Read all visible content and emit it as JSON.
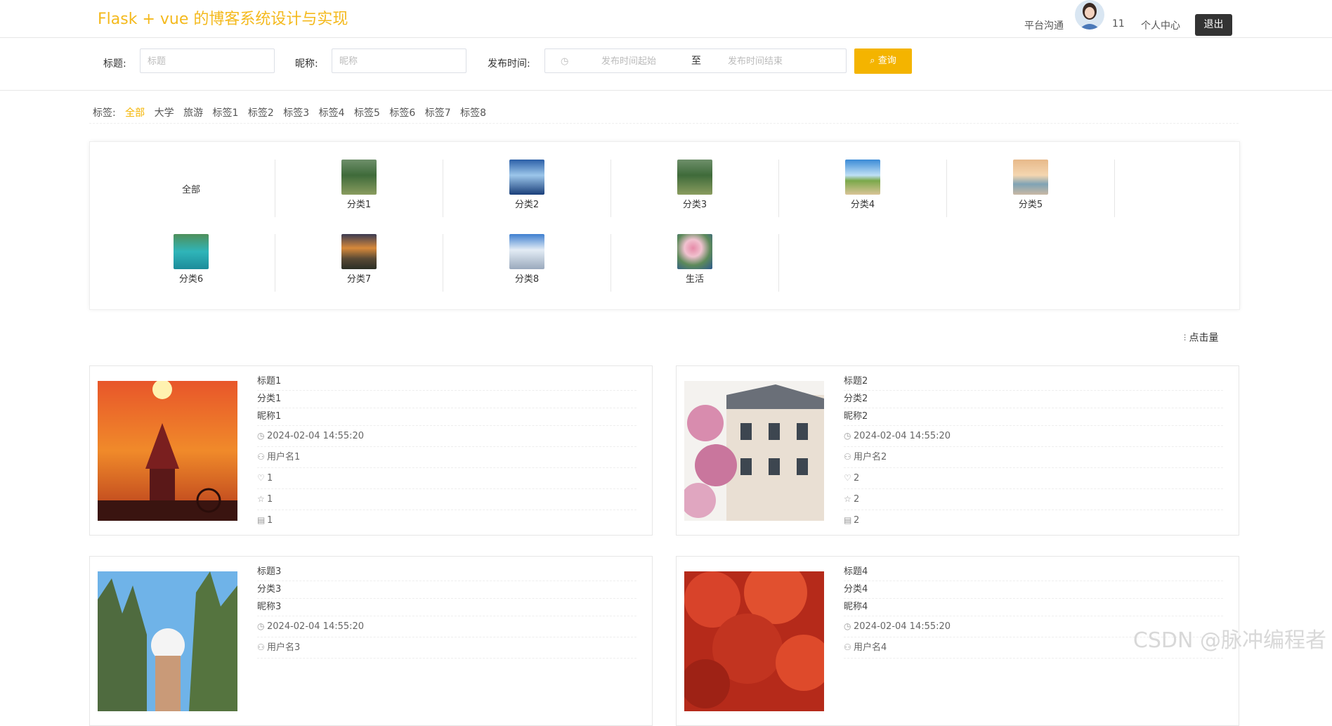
{
  "header": {
    "site_title": "Flask + vue 的博客系统设计与实现",
    "chat_link": "平台沟通",
    "count": "11",
    "profile_link": "个人中心",
    "logout_label": "退出"
  },
  "search": {
    "title_label": "标题:",
    "title_placeholder": "标题",
    "nickname_label": "昵称:",
    "nickname_placeholder": "昵称",
    "time_label": "发布时间:",
    "start_placeholder": "发布时间起始",
    "range_sep": "至",
    "end_placeholder": "发布时间结束",
    "query_label": "查询"
  },
  "tags": {
    "label": "标签:",
    "items": [
      "全部",
      "大学",
      "旅游",
      "标签1",
      "标签2",
      "标签3",
      "标签4",
      "标签5",
      "标签6",
      "标签7",
      "标签8"
    ],
    "active": "全部"
  },
  "categories": [
    {
      "label": "全部",
      "thumb": "none"
    },
    {
      "label": "分类1",
      "thumb": "mountain-green"
    },
    {
      "label": "分类2",
      "thumb": "lake-blue"
    },
    {
      "label": "分类3",
      "thumb": "mountain-green"
    },
    {
      "label": "分类4",
      "thumb": "field-sky"
    },
    {
      "label": "分类5",
      "thumb": "sunset-beach"
    },
    {
      "label": "分类6",
      "thumb": "bay-turquoise"
    },
    {
      "label": "分类7",
      "thumb": "sunset-valley"
    },
    {
      "label": "分类8",
      "thumb": "snow-peaks"
    },
    {
      "label": "生活",
      "thumb": "flowers"
    }
  ],
  "sort_label": "点击量",
  "posts": [
    {
      "title": "标题1",
      "category": "分类1",
      "nickname": "昵称1",
      "time": "2024-02-04 14:55:20",
      "user": "用户名1",
      "likes": "1",
      "favorites": "1",
      "comments": "1",
      "image": "sunset-lighthouse"
    },
    {
      "title": "标题2",
      "category": "分类2",
      "nickname": "昵称2",
      "time": "2024-02-04 14:55:20",
      "user": "用户名2",
      "likes": "2",
      "favorites": "2",
      "comments": "2",
      "image": "magnolia-building"
    },
    {
      "title": "标题3",
      "category": "分类3",
      "nickname": "昵称3",
      "time": "2024-02-04 14:55:20",
      "user": "用户名3",
      "image": "karst-peaks"
    },
    {
      "title": "标题4",
      "category": "分类4",
      "nickname": "昵称4",
      "time": "2024-02-04 14:55:20",
      "user": "用户名4",
      "image": "red-maple"
    }
  ],
  "watermark": "CSDN @脉冲编程者",
  "colors": {
    "accent": "#f4b400",
    "title": "#f4b91c",
    "dark_button": "#333333"
  }
}
